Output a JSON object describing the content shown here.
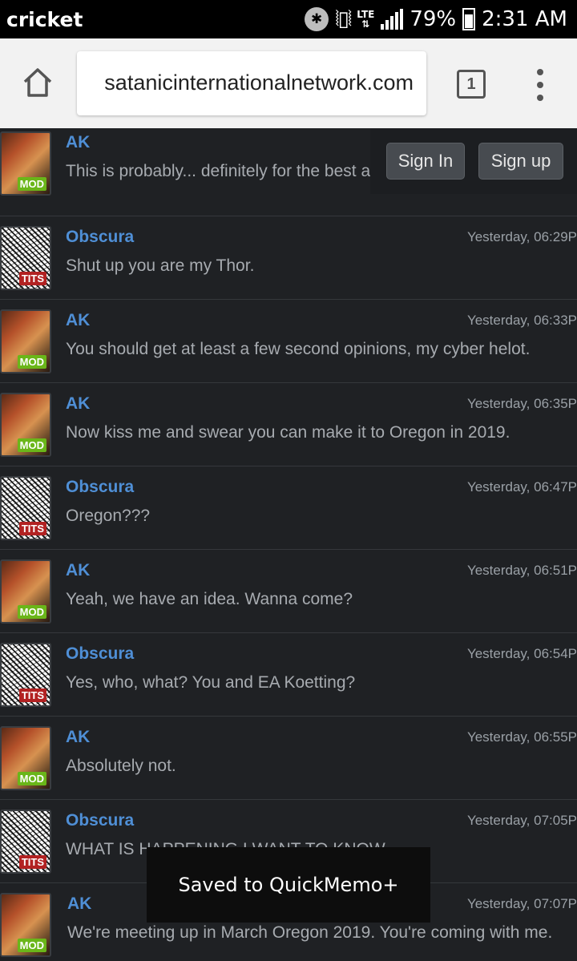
{
  "status_bar": {
    "carrier": "cricket",
    "network": "LTE",
    "battery": "79%",
    "time": "2:31 AM"
  },
  "browser": {
    "url": "satanicinternationalnetwork.com",
    "tab_count": "1"
  },
  "auth": {
    "sign_in": "Sign In",
    "sign_up": "Sign up"
  },
  "messages": [
    {
      "user": "AK",
      "badge": "MOD",
      "time": "",
      "text": "This is probably... definitely for the best as far as me is concerned."
    },
    {
      "user": "Obscura",
      "badge": "TITS",
      "time": "Yesterday, 06:29P",
      "text": "Shut up you are my Thor."
    },
    {
      "user": "AK",
      "badge": "MOD",
      "time": "Yesterday, 06:33P",
      "text": "You should get at least a few second opinions, my cyber helot."
    },
    {
      "user": "AK",
      "badge": "MOD",
      "time": "Yesterday, 06:35P",
      "text": "Now kiss me and swear you can make it to Oregon in 2019."
    },
    {
      "user": "Obscura",
      "badge": "TITS",
      "time": "Yesterday, 06:47P",
      "text": "Oregon???"
    },
    {
      "user": "AK",
      "badge": "MOD",
      "time": "Yesterday, 06:51P",
      "text": "Yeah, we have an idea. Wanna come?"
    },
    {
      "user": "Obscura",
      "badge": "TITS",
      "time": "Yesterday, 06:54P",
      "text": "Yes, who, what? You and EA Koetting?"
    },
    {
      "user": "AK",
      "badge": "MOD",
      "time": "Yesterday, 06:55P",
      "text": "Absolutely not."
    },
    {
      "user": "Obscura",
      "badge": "TITS",
      "time": "Yesterday, 07:05P",
      "text": "WHAT IS HAPPENING I WANT TO KNOW"
    },
    {
      "user": "AK",
      "badge": "MOD",
      "time": "Yesterday, 07:07P",
      "text": "We're meeting up in March Oregon 2019. You're coming with me."
    }
  ],
  "toast": "Saved to QuickMemo+"
}
